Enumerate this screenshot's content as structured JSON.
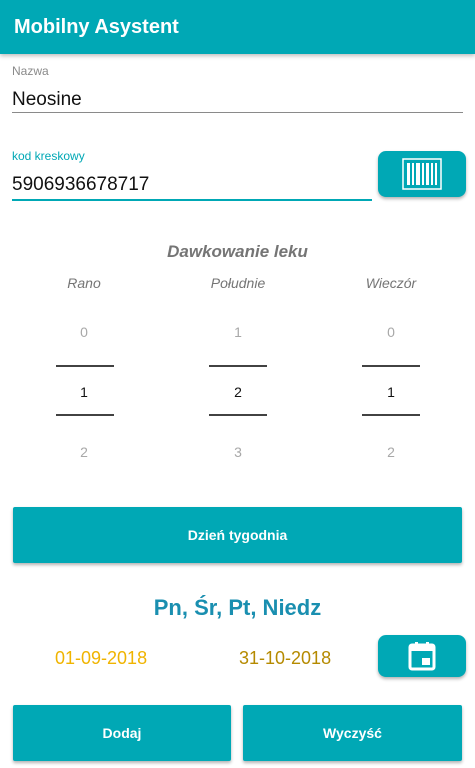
{
  "appbar": {
    "title": "Mobilny Asystent"
  },
  "name_field": {
    "label": "Nazwa",
    "value": "Neosine"
  },
  "barcode_field": {
    "label": "kod kreskowy",
    "value": "5906936678717"
  },
  "barcode_button": {
    "icon": "barcode-icon"
  },
  "dosage": {
    "title": "Dawkowanie leku",
    "columns": [
      {
        "header": "Rano",
        "prev": "0",
        "selected": "1",
        "next": "2"
      },
      {
        "header": "Południe",
        "prev": "1",
        "selected": "2",
        "next": "3"
      },
      {
        "header": "Wieczór",
        "prev": "0",
        "selected": "1",
        "next": "2"
      }
    ]
  },
  "weekday_button": {
    "label": "Dzień tygodnia"
  },
  "selected_days": "Pn, Śr, Pt, Niedz",
  "dates": {
    "start": "01-09-2018",
    "end": "31-10-2018"
  },
  "calendar_button": {
    "icon": "calendar-icon"
  },
  "actions": {
    "add_label": "Dodaj",
    "clear_label": "Wyczyść"
  },
  "colors": {
    "accent": "#00a8b5",
    "days": "#1a8fb0",
    "start_date": "#f0b400",
    "end_date": "#b58a00"
  }
}
